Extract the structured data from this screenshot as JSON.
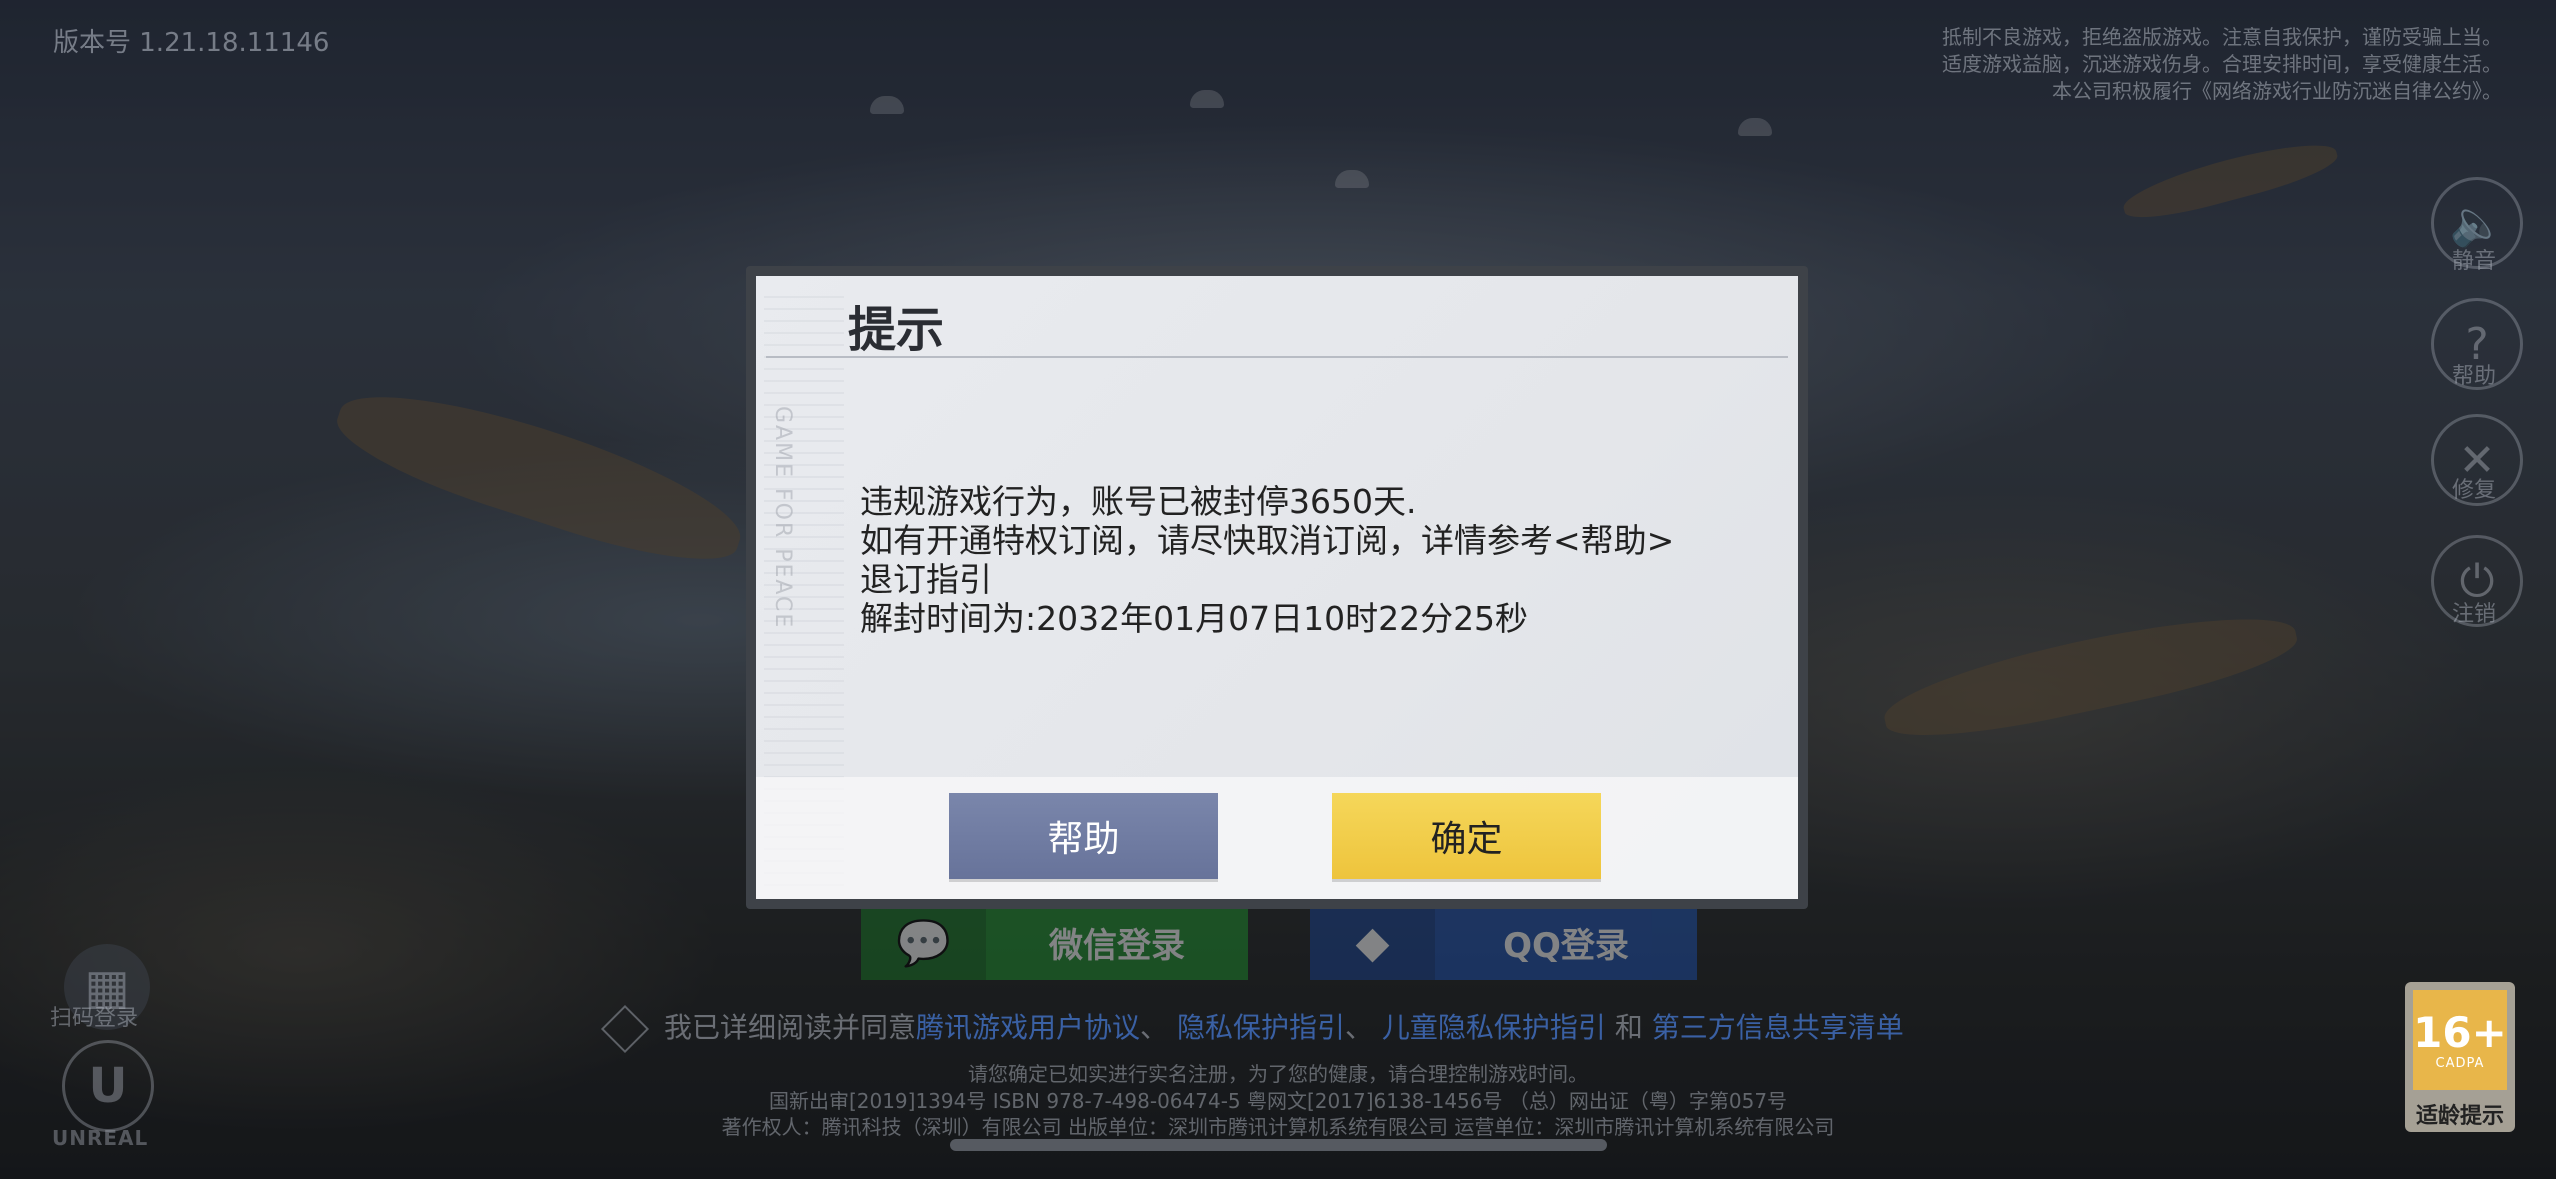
{
  "version": "版本号 1.21.18.11146",
  "top_notice": [
    "抵制不良游戏，拒绝盗版游戏。注意自我保护，谨防受骗上当。",
    "适度游戏益脑，沉迷游戏伤身。合理安排时间，享受健康生活。",
    "本公司积极履行《网络游戏行业防沉迷自律公约》。"
  ],
  "side_buttons": [
    {
      "icon": "speaker-icon",
      "glyph": "🔈",
      "label": "静音"
    },
    {
      "icon": "help-icon",
      "glyph": "?",
      "label": "帮助"
    },
    {
      "icon": "repair-icon",
      "glyph": "✕",
      "label": "修复"
    },
    {
      "icon": "power-icon",
      "glyph": "⏻",
      "label": "注销"
    }
  ],
  "login": {
    "wechat_label": "微信登录",
    "qq_label": "QQ登录"
  },
  "agreement": {
    "prefix": "我已详细阅读并同意",
    "link1": "腾讯游戏用户协议",
    "sep1": "、",
    "link2": "隐私保护指引",
    "sep2": "、",
    "link3": "儿童隐私保护指引",
    "and": "和",
    "link4": "第三方信息共享清单"
  },
  "footer": {
    "line1": "请您确定已如实进行实名注册，为了您的健康，请合理控制游戏时间。",
    "line2": "国新出审[2019]1394号   ISBN 978-7-498-06474-5   粤网文[2017]6138-1456号   （总）网出证（粤）字第057号",
    "line3": "著作权人：腾讯科技（深圳）有限公司    出版单位：深圳市腾讯计算机系统有限公司    运营单位：深圳市腾讯计算机系统有限公司"
  },
  "scan_label": "扫码登录",
  "unreal_text": "UNREAL",
  "age_rating": {
    "number": "16+",
    "tag": "CADPA",
    "label": "适龄提示"
  },
  "dialog": {
    "title": "提示",
    "watermark": "GAME FOR PEACE",
    "lines": [
      "违规游戏行为，账号已被封停3650天.",
      "如有开通特权订阅，请尽快取消订阅，详情参考<帮助>",
      "退订指引",
      "解封时间为:2032年01月07日10时22分25秒"
    ],
    "help_button": "帮助",
    "ok_button": "确定"
  }
}
